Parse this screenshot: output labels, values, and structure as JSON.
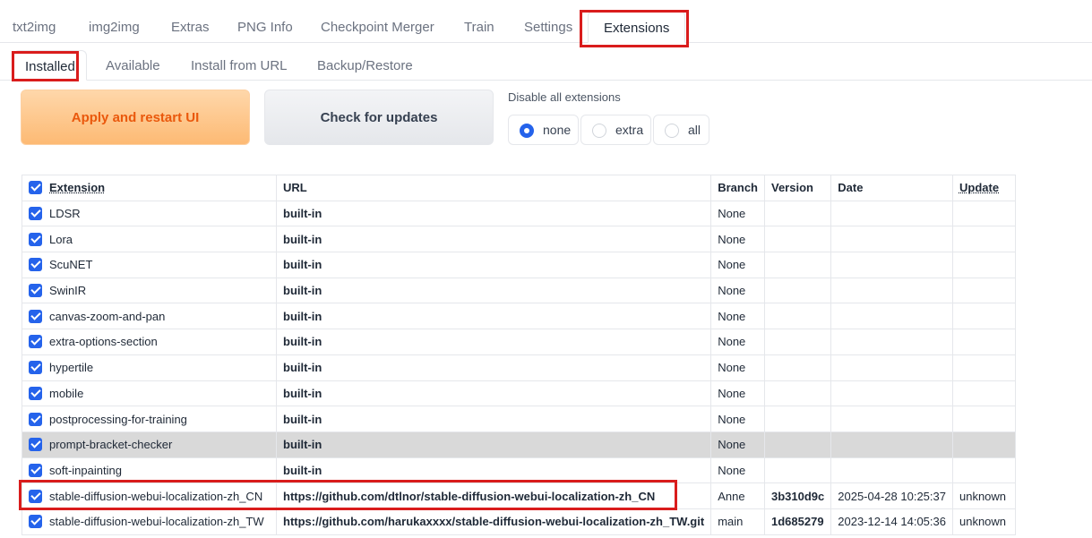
{
  "top_tabs": [
    "txt2img",
    "img2img",
    "Extras",
    "PNG Info",
    "Checkpoint Merger",
    "Train",
    "Settings",
    "Extensions"
  ],
  "active_top_tab": "Extensions",
  "sub_tabs": [
    "Installed",
    "Available",
    "Install from URL",
    "Backup/Restore"
  ],
  "active_sub_tab": "Installed",
  "buttons": {
    "apply": "Apply and restart UI",
    "check": "Check for updates"
  },
  "disable": {
    "label": "Disable all extensions",
    "options": [
      "none",
      "extra",
      "all"
    ],
    "selected": "none"
  },
  "table": {
    "headers": [
      "Extension",
      "URL",
      "Branch",
      "Version",
      "Date",
      "Update"
    ],
    "rows": [
      {
        "name": "LDSR",
        "url": "built-in",
        "branch": "None",
        "version": "",
        "date": "",
        "update": ""
      },
      {
        "name": "Lora",
        "url": "built-in",
        "branch": "None",
        "version": "",
        "date": "",
        "update": ""
      },
      {
        "name": "ScuNET",
        "url": "built-in",
        "branch": "None",
        "version": "",
        "date": "",
        "update": ""
      },
      {
        "name": "SwinIR",
        "url": "built-in",
        "branch": "None",
        "version": "",
        "date": "",
        "update": ""
      },
      {
        "name": "canvas-zoom-and-pan",
        "url": "built-in",
        "branch": "None",
        "version": "",
        "date": "",
        "update": ""
      },
      {
        "name": "extra-options-section",
        "url": "built-in",
        "branch": "None",
        "version": "",
        "date": "",
        "update": ""
      },
      {
        "name": "hypertile",
        "url": "built-in",
        "branch": "None",
        "version": "",
        "date": "",
        "update": ""
      },
      {
        "name": "mobile",
        "url": "built-in",
        "branch": "None",
        "version": "",
        "date": "",
        "update": ""
      },
      {
        "name": "postprocessing-for-training",
        "url": "built-in",
        "branch": "None",
        "version": "",
        "date": "",
        "update": ""
      },
      {
        "name": "prompt-bracket-checker",
        "url": "built-in",
        "branch": "None",
        "version": "",
        "date": "",
        "update": ""
      },
      {
        "name": "soft-inpainting",
        "url": "built-in",
        "branch": "None",
        "version": "",
        "date": "",
        "update": ""
      },
      {
        "name": "stable-diffusion-webui-localization-zh_CN",
        "url": "https://github.com/dtlnor/stable-diffusion-webui-localization-zh_CN",
        "branch": "Anne",
        "version": "3b310d9c",
        "date": "2025-04-28 10:25:37",
        "update": "unknown"
      },
      {
        "name": "stable-diffusion-webui-localization-zh_TW",
        "url": "https://github.com/harukaxxxx/stable-diffusion-webui-localization-zh_TW.git",
        "branch": "main",
        "version": "1d685279",
        "date": "2023-12-14 14:05:36",
        "update": "unknown"
      }
    ]
  },
  "colors": {
    "highlight_box": "#d91c1c",
    "accent_blue": "#2563eb",
    "apply_orange": "#ea580c"
  }
}
